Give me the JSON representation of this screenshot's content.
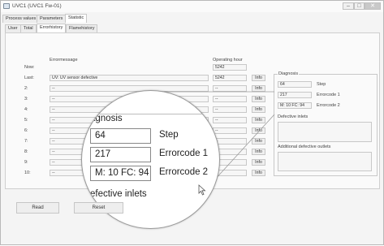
{
  "window": {
    "title": "UVC1 (UVC1 Fw-01)",
    "controls": [
      "–",
      "□",
      "✕"
    ]
  },
  "tabs_main": [
    "Process values",
    "Parameters",
    "Statistic"
  ],
  "tabs_sub": [
    "User",
    "Total",
    "Errorhistory",
    "Flamehistory"
  ],
  "headers": {
    "errormessage": "Errormessage",
    "operating_hour": "Operating hour"
  },
  "now": {
    "label": "Now:",
    "hours": "5242"
  },
  "rows": [
    {
      "label": "Last:",
      "message": "UV: UV sensor defective",
      "hours": "5242",
      "info": "Info"
    },
    {
      "label": "2:",
      "message": "--",
      "hours": "--",
      "info": "Info"
    },
    {
      "label": "3:",
      "message": "--",
      "hours": "--",
      "info": "Info"
    },
    {
      "label": "4:",
      "message": "--",
      "hours": "--",
      "info": "Info"
    },
    {
      "label": "5:",
      "message": "--",
      "hours": "--",
      "info": "Info"
    },
    {
      "label": "6:",
      "message": "--",
      "hours": "--",
      "info": "Info"
    },
    {
      "label": "7:",
      "message": "--",
      "hours": "--",
      "info": "Info"
    },
    {
      "label": "8:",
      "message": "--",
      "hours": "--",
      "info": "Info"
    },
    {
      "label": "9:",
      "message": "--",
      "hours": "--",
      "info": "Info"
    },
    {
      "label": "10:",
      "message": "--",
      "hours": "--",
      "info": "Info"
    }
  ],
  "diagnosis": {
    "title": "Diagnosis",
    "step_value": "64",
    "step_label": "Step",
    "err1_value": "217",
    "err1_label": "Errorcode 1",
    "err2_value": "M: 10 FC: 94",
    "err2_label": "Errorcode 2",
    "defective_inlets_label": "Defective inlets",
    "defective_outlets_label": "Additional defective outlets"
  },
  "zoom": {
    "title": "agnosis",
    "step_value": "64",
    "step_label": "Step",
    "err1_value": "217",
    "err1_label": "Errorcode 1",
    "err2_value": "M: 10 FC: 94",
    "err2_label": "Errorcode 2",
    "defective_inlets_label": "efective inlets"
  },
  "buttons": {
    "read": "Read",
    "reset": "Reset"
  }
}
